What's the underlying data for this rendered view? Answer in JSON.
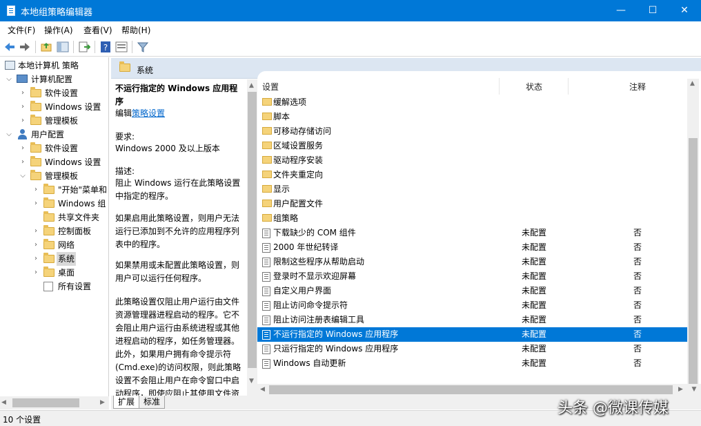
{
  "window": {
    "title": "本地组策略编辑器",
    "minimize": "—",
    "maximize": "☐",
    "close": "✕"
  },
  "menu": [
    "文件(F)",
    "操作(A)",
    "查看(V)",
    "帮助(H)"
  ],
  "tree": {
    "root": "本地计算机 策略",
    "computer_config": "计算机配置",
    "cc_software": "软件设置",
    "cc_windows": "Windows 设置",
    "cc_admin": "管理模板",
    "user_config": "用户配置",
    "uc_software": "软件设置",
    "uc_windows": "Windows 设置",
    "uc_admin": "管理模板",
    "at_start": "\"开始\"菜单和",
    "at_windows": "Windows 组",
    "at_shared": "共享文件夹",
    "at_control": "控制面板",
    "at_network": "网络",
    "at_system": "系统",
    "at_desktop": "桌面",
    "at_all": "所有设置"
  },
  "header": {
    "folder": "系统"
  },
  "description": {
    "title": "不运行指定的 Windows 应用程序",
    "edit_prefix": "编辑",
    "edit_link": "策略设置",
    "req_label": "要求:",
    "req_value": "Windows 2000 及以上版本",
    "desc_label": "描述:",
    "desc1": "阻止 Windows 运行在此策略设置中指定的程序。",
    "desc2": "如果启用此策略设置，则用户无法运行已添加到不允许的应用程序列表中的程序。",
    "desc3": "如果禁用或未配置此策略设置，则用户可以运行任何程序。",
    "desc4": "此策略设置仅阻止用户运行由文件资源管理器进程启动的程序。它不会阻止用户运行由系统进程或其他进程启动的程序，如任务管理器。此外，如果用户拥有命令提示符(Cmd.exe)的访问权限，则此策略设置不会阻止用户在命令窗口中启动程序，即使应阻止其使用文件资源管理器启动程序也会如此"
  },
  "columns": {
    "setting": "设置",
    "state": "状态",
    "comment": "注释"
  },
  "folders": [
    "缓解选项",
    "脚本",
    "可移动存储访问",
    "区域设置服务",
    "驱动程序安装",
    "文件夹重定向",
    "显示",
    "用户配置文件",
    "组策略"
  ],
  "policies": [
    {
      "name": "下载缺少的 COM 组件",
      "state": "未配置",
      "comment": "否"
    },
    {
      "name": "2000 年世纪转译",
      "state": "未配置",
      "comment": "否"
    },
    {
      "name": "限制这些程序从帮助启动",
      "state": "未配置",
      "comment": "否"
    },
    {
      "name": "登录时不显示欢迎屏幕",
      "state": "未配置",
      "comment": "否"
    },
    {
      "name": "自定义用户界面",
      "state": "未配置",
      "comment": "否"
    },
    {
      "name": "阻止访问命令提示符",
      "state": "未配置",
      "comment": "否"
    },
    {
      "name": "阻止访问注册表编辑工具",
      "state": "未配置",
      "comment": "否"
    },
    {
      "name": "不运行指定的 Windows 应用程序",
      "state": "未配置",
      "comment": "否"
    },
    {
      "name": "只运行指定的 Windows 应用程序",
      "state": "未配置",
      "comment": "否"
    },
    {
      "name": "Windows 自动更新",
      "state": "未配置",
      "comment": "否"
    }
  ],
  "tabs": {
    "extended": "扩展",
    "standard": "标准"
  },
  "status": "10 个设置",
  "watermark": "头条 @微课传媒",
  "colors": {
    "titlebar": "#0078d7",
    "selection": "#0078d7",
    "header": "#dce6f2"
  }
}
